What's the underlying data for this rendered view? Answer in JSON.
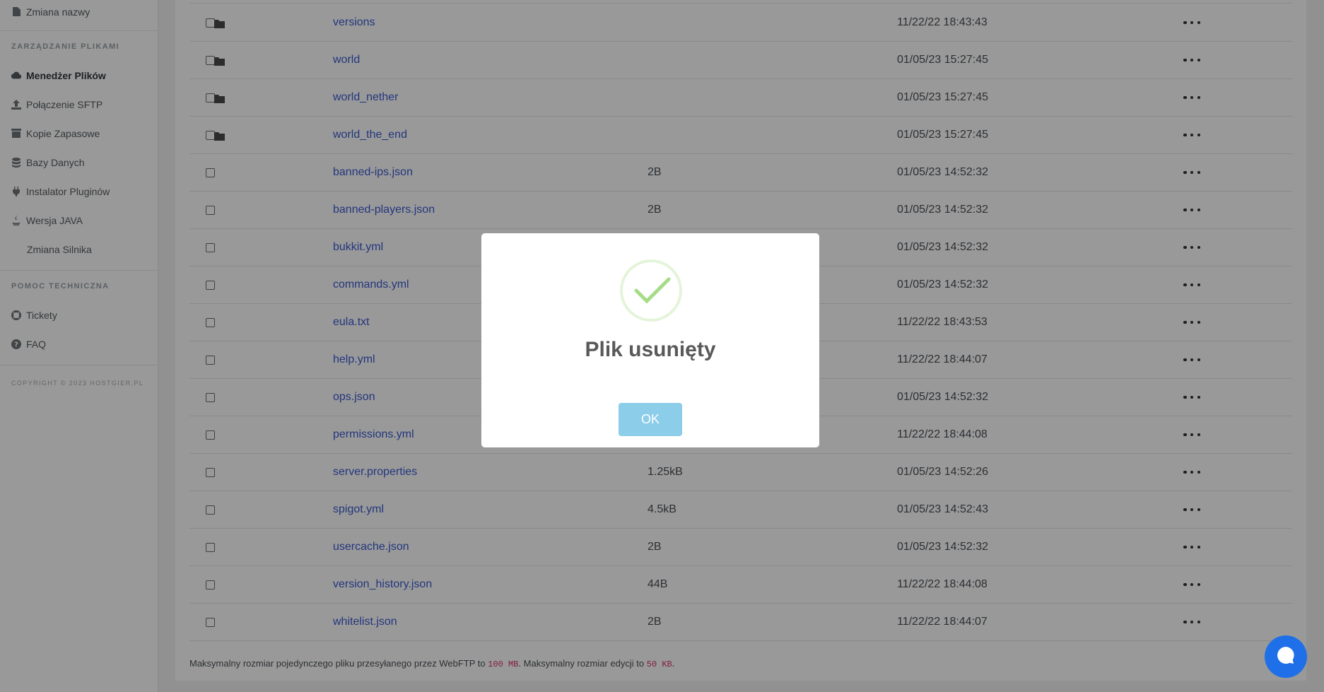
{
  "sidebar": {
    "top_item": "Zmiana nazwy",
    "section_files": "ZARZĄDZANIE PLIKAMI",
    "file_items": [
      {
        "label": "Menedżer Plików",
        "icon": "cloud-icon"
      },
      {
        "label": "Połączenie SFTP",
        "icon": "upload-icon"
      },
      {
        "label": "Kopie Zapasowe",
        "icon": "archive-icon"
      },
      {
        "label": "Bazy Danych",
        "icon": "database-icon"
      },
      {
        "label": "Instalator Pluginów",
        "icon": "plug-icon"
      },
      {
        "label": "Wersja JAVA",
        "icon": "java-icon"
      },
      {
        "label": "Zmiana Silnika",
        "icon": ""
      }
    ],
    "section_support": "POMOC TECHNICZNA",
    "support_items": [
      {
        "label": "Tickety",
        "icon": "lifebuoy-icon"
      },
      {
        "label": "FAQ",
        "icon": "question-icon"
      }
    ],
    "copyright": "COPYRIGHT © 2023 HOSTGIER.PL"
  },
  "files": [
    {
      "name": "versions",
      "type": "folder",
      "size": "",
      "date": "11/22/22 18:43:43"
    },
    {
      "name": "world",
      "type": "folder",
      "size": "",
      "date": "01/05/23 15:27:45"
    },
    {
      "name": "world_nether",
      "type": "folder",
      "size": "",
      "date": "01/05/23 15:27:45"
    },
    {
      "name": "world_the_end",
      "type": "folder",
      "size": "",
      "date": "01/05/23 15:27:45"
    },
    {
      "name": "banned-ips.json",
      "type": "file",
      "size": "2B",
      "date": "01/05/23 14:52:32"
    },
    {
      "name": "banned-players.json",
      "type": "file",
      "size": "2B",
      "date": "01/05/23 14:52:32"
    },
    {
      "name": "bukkit.yml",
      "type": "file",
      "size": "",
      "date": "01/05/23 14:52:32"
    },
    {
      "name": "commands.yml",
      "type": "file",
      "size": "",
      "date": "01/05/23 14:52:32"
    },
    {
      "name": "eula.txt",
      "type": "file",
      "size": "",
      "date": "11/22/22 18:43:53"
    },
    {
      "name": "help.yml",
      "type": "file",
      "size": "",
      "date": "11/22/22 18:44:07"
    },
    {
      "name": "ops.json",
      "type": "file",
      "size": "",
      "date": "01/05/23 14:52:32"
    },
    {
      "name": "permissions.yml",
      "type": "file",
      "size": "",
      "date": "11/22/22 18:44:08"
    },
    {
      "name": "server.properties",
      "type": "file",
      "size": "1.25kB",
      "date": "01/05/23 14:52:26"
    },
    {
      "name": "spigot.yml",
      "type": "file",
      "size": "4.5kB",
      "date": "01/05/23 14:52:43"
    },
    {
      "name": "usercache.json",
      "type": "file",
      "size": "2B",
      "date": "01/05/23 14:52:32"
    },
    {
      "name": "version_history.json",
      "type": "file",
      "size": "44B",
      "date": "11/22/22 18:44:08"
    },
    {
      "name": "whitelist.json",
      "type": "file",
      "size": "2B",
      "date": "11/22/22 18:44:07"
    }
  ],
  "footer": {
    "text_1": "Maksymalny rozmiar pojedynczego pliku przesyłanego przez WebFTP to ",
    "max_upload": "100 MB",
    "text_2": ". Maksymalny rozmiar edycji to ",
    "max_edit": "50 KB",
    "text_3": "."
  },
  "modal": {
    "title": "Plik usunięty",
    "ok_label": "OK",
    "icon": "success-check-icon"
  },
  "colors": {
    "link": "#3b5bd0",
    "ok_button": "#8ccde9",
    "success": "#a5dc86",
    "chat": "#1e6fe8"
  }
}
